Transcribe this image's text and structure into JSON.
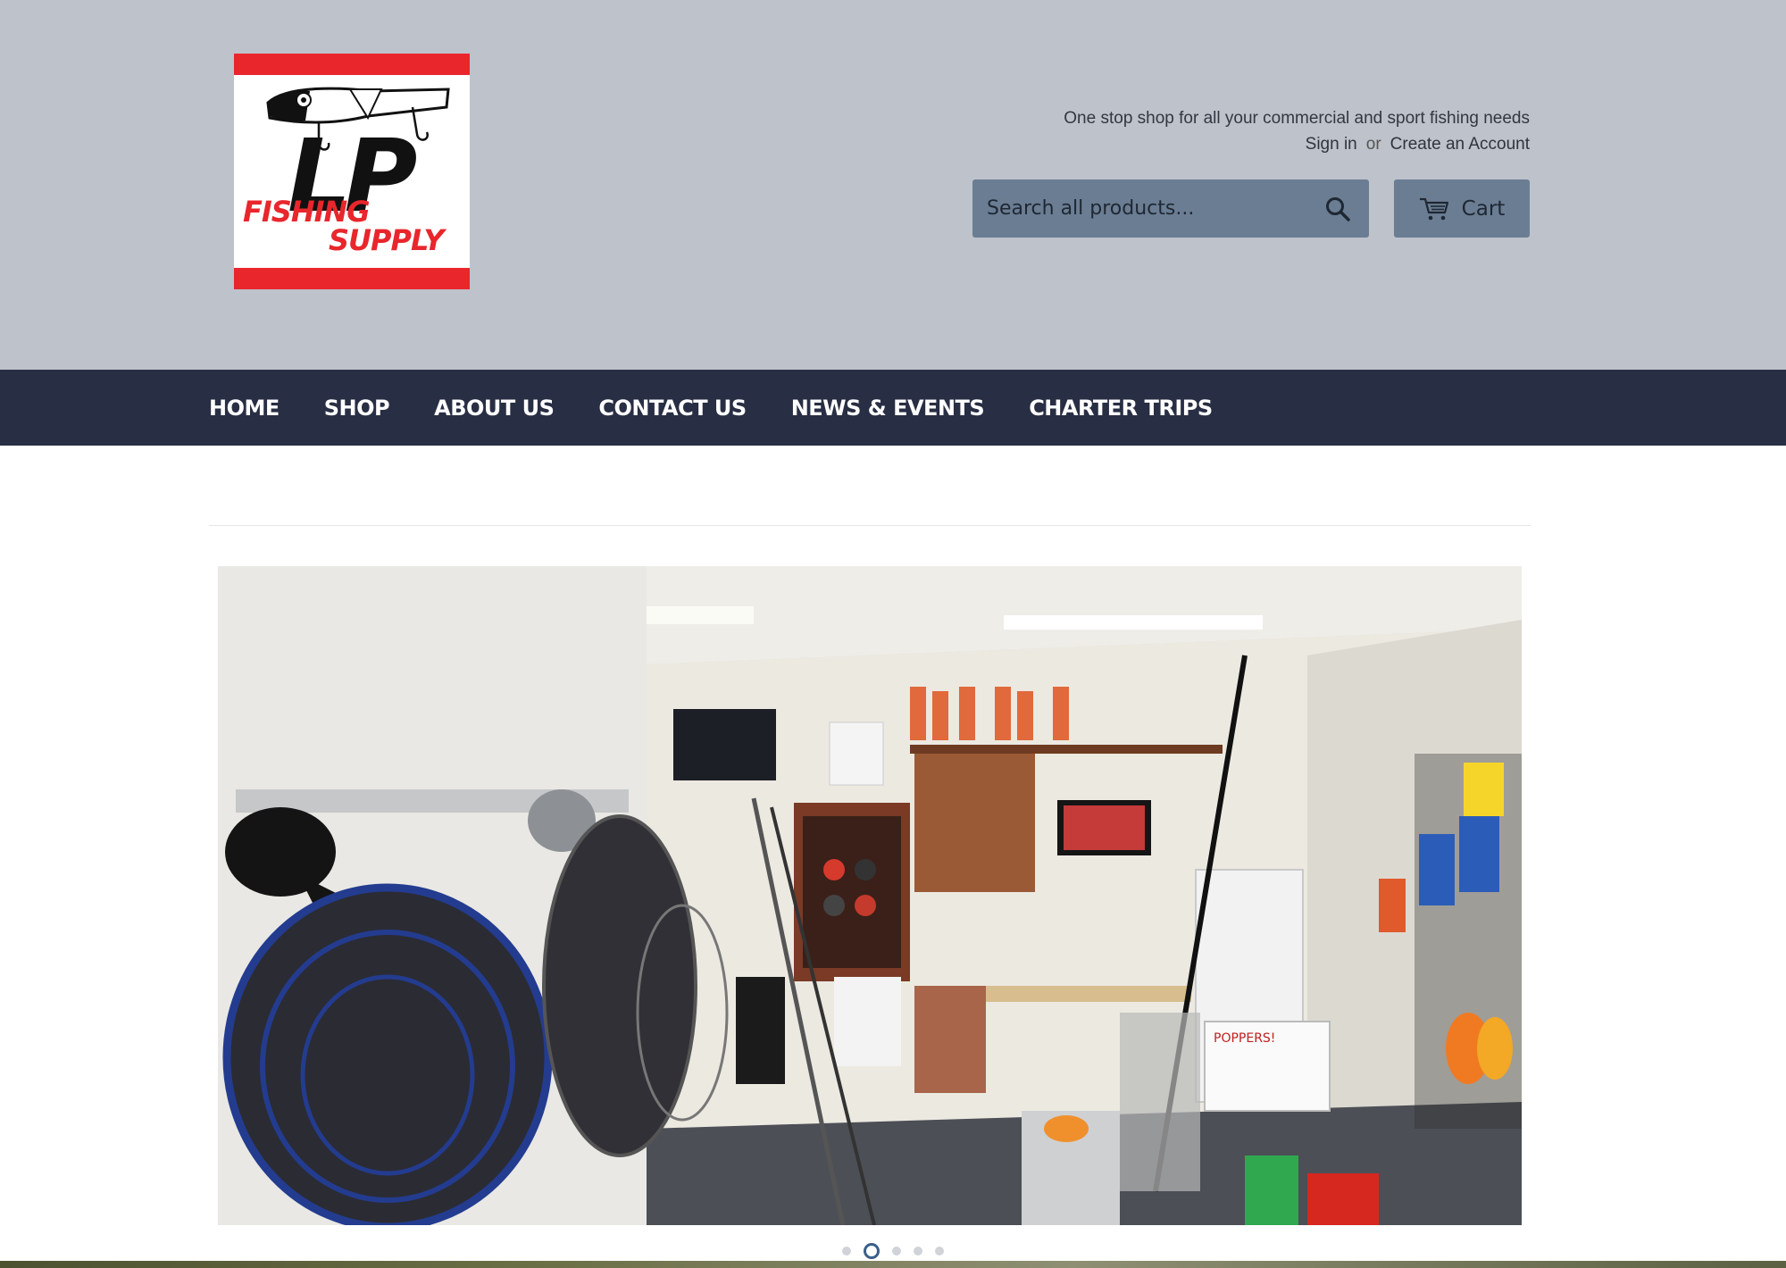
{
  "header": {
    "logo": {
      "line1": "LP",
      "line2": "FISHING",
      "line3": "SUPPLY"
    },
    "tagline": "One stop shop for all your commercial and sport fishing needs",
    "sign_in": "Sign in",
    "or": "or",
    "create_account": "Create an Account",
    "search": {
      "placeholder": "Search all products..."
    },
    "cart_label": "Cart"
  },
  "nav": {
    "items": [
      {
        "label": "HOME"
      },
      {
        "label": "SHOP"
      },
      {
        "label": "ABOUT US"
      },
      {
        "label": "CONTACT US"
      },
      {
        "label": "NEWS & EVENTS"
      },
      {
        "label": "CHARTER TRIPS"
      }
    ]
  },
  "slideshow": {
    "slide_count": 5,
    "active_index": 1,
    "photo_sign_text": "POPPERS!"
  },
  "colors": {
    "header_bg": "#bdc2cb",
    "nav_bg": "#282e43",
    "button_bg": "#6a7d93",
    "logo_red": "#e8262c"
  }
}
